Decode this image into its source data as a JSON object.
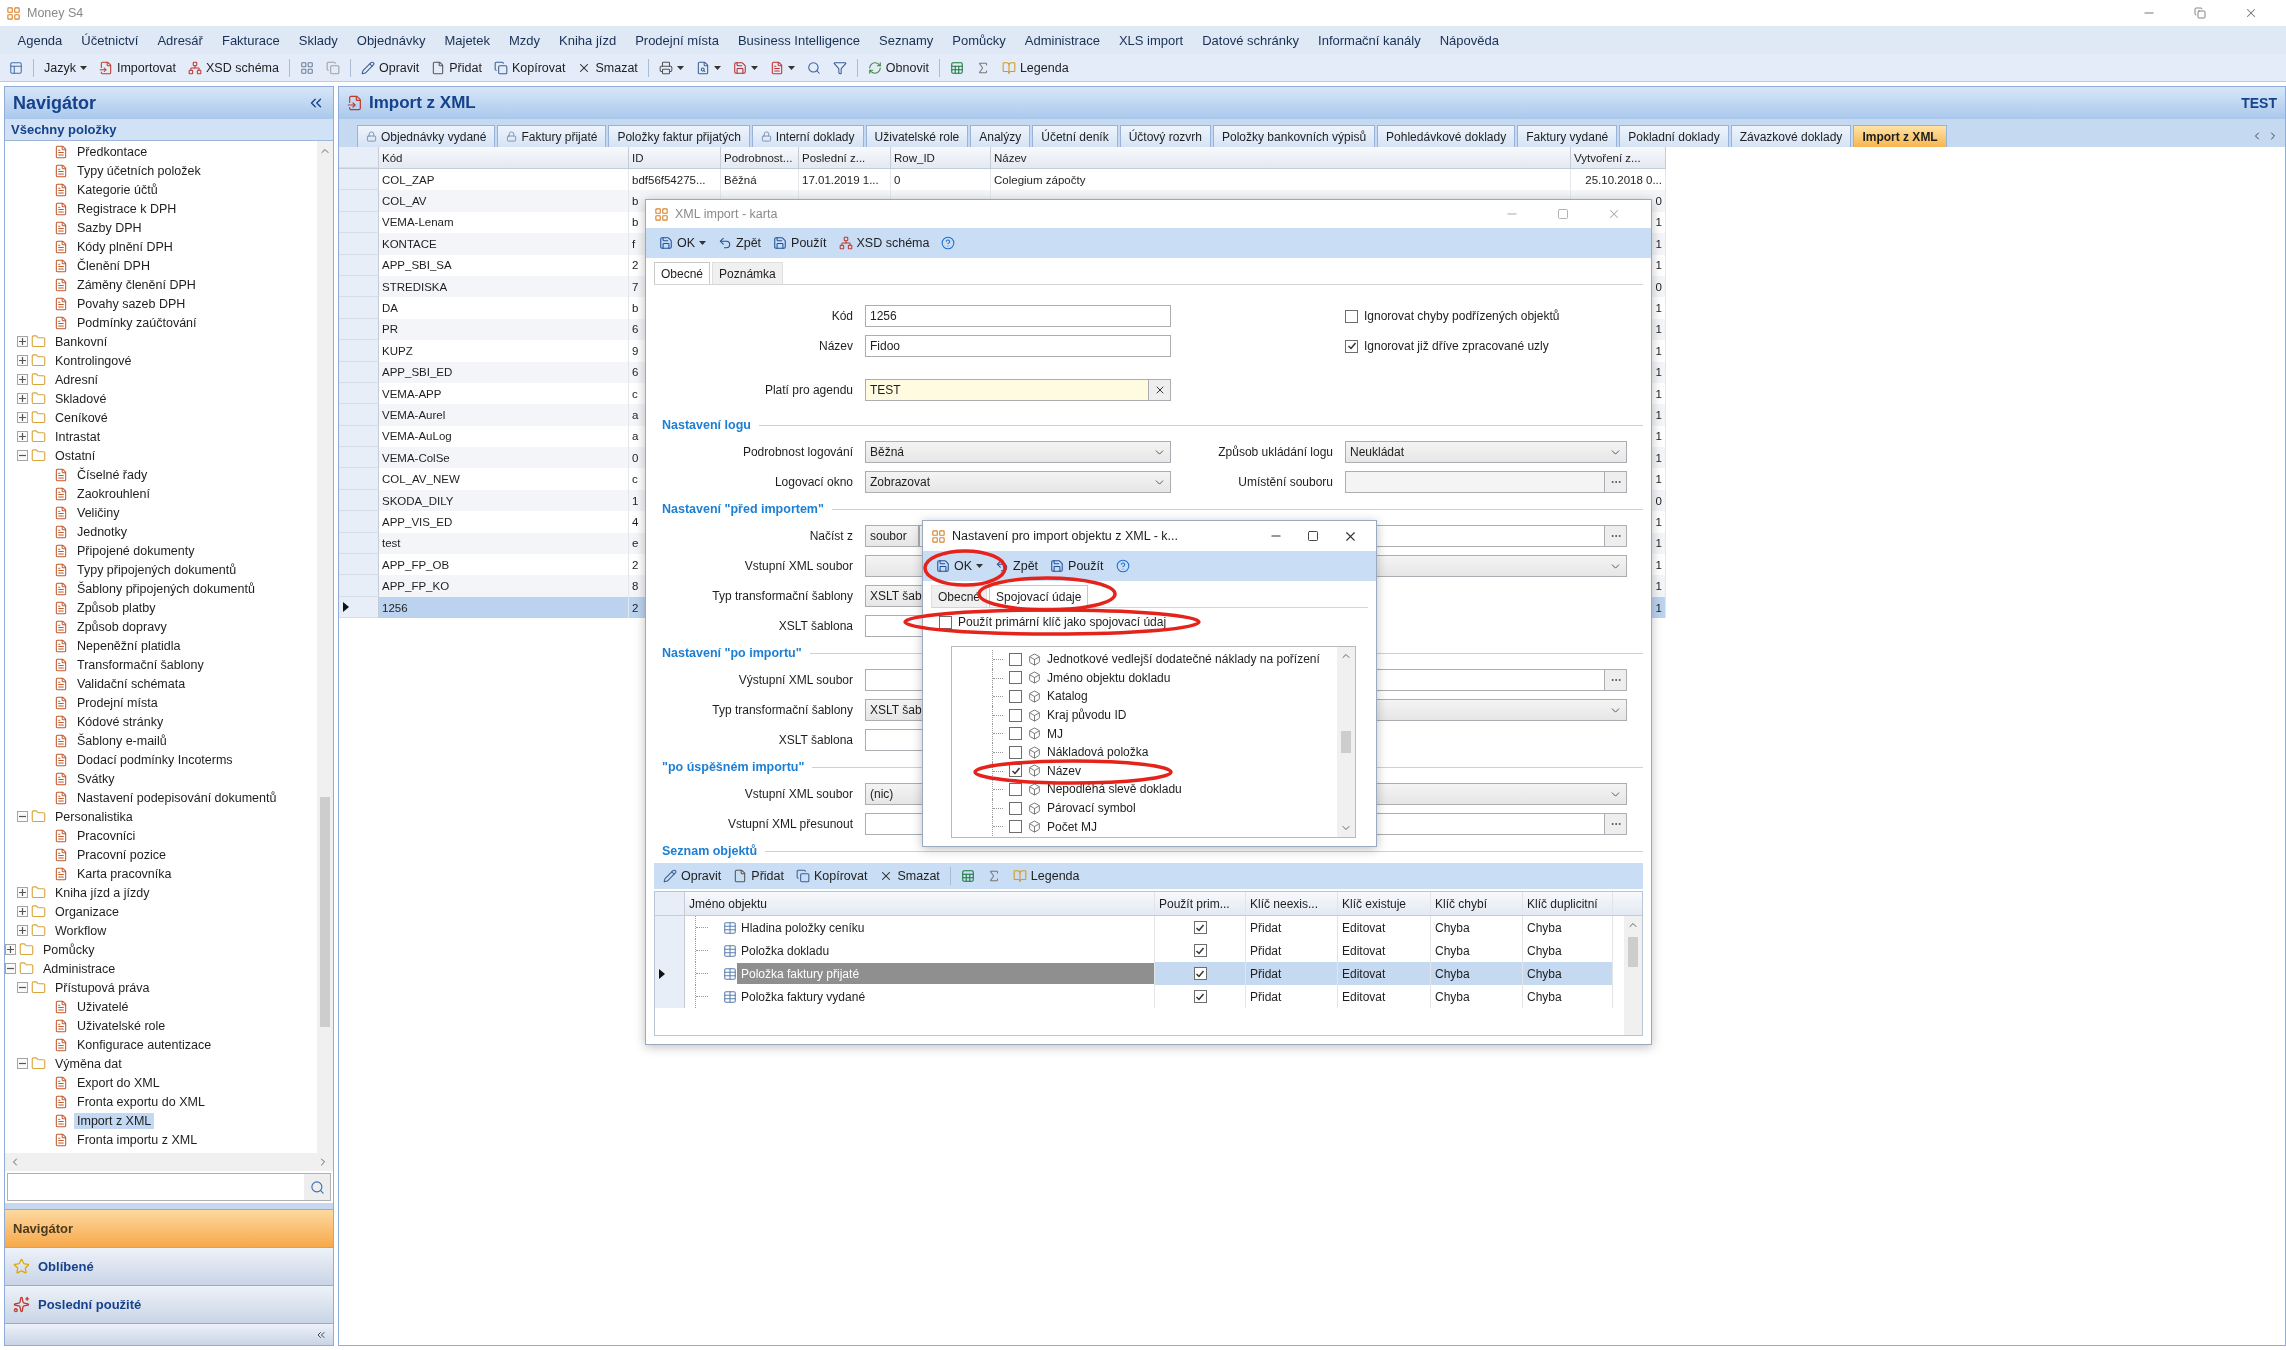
{
  "window": {
    "title": "Money S4"
  },
  "menu": [
    "Agenda",
    "Účetnictví",
    "Adresář",
    "Fakturace",
    "Sklady",
    "Objednávky",
    "Majetek",
    "Mzdy",
    "Kniha jízd",
    "Prodejní místa",
    "Business Intelligence",
    "Seznamy",
    "Pomůcky",
    "Administrace",
    "XLS import",
    "Datové schránky",
    "Informační kanály",
    "Nápověda"
  ],
  "toolbar": [
    {
      "kind": "icon"
    },
    {
      "kind": "button",
      "label": "Jazyk",
      "caret": true
    },
    {
      "kind": "button",
      "label": "Importovat"
    },
    {
      "kind": "button",
      "label": "XSD schéma"
    },
    {
      "kind": "icon"
    },
    {
      "kind": "icon"
    },
    {
      "kind": "button",
      "label": "Opravit"
    },
    {
      "kind": "button",
      "label": "Přidat"
    },
    {
      "kind": "button",
      "label": "Kopírovat"
    },
    {
      "kind": "button",
      "label": "Smazat"
    },
    {
      "kind": "icon",
      "caret": true
    },
    {
      "kind": "icon",
      "caret": true
    },
    {
      "kind": "icon",
      "caret": true
    },
    {
      "kind": "icon",
      "caret": true
    },
    {
      "kind": "icon"
    },
    {
      "kind": "icon"
    },
    {
      "kind": "button",
      "label": "Obnovit"
    },
    {
      "kind": "icon"
    },
    {
      "kind": "icon"
    },
    {
      "kind": "button",
      "label": "Legenda"
    }
  ],
  "navigator": {
    "title": "Navigátor",
    "group": "Všechny položky",
    "tree": [
      {
        "children": [
          {
            "children": [
              {
                "label": "Předkontace",
                "selected": false
              },
              {
                "label": "Typy účetních položek",
                "selected": false
              },
              {
                "label": "Kategorie účtů",
                "selected": false
              },
              {
                "label": "Registrace k DPH",
                "selected": false
              },
              {
                "label": "Sazby DPH",
                "selected": false
              },
              {
                "label": "Kódy plnění DPH",
                "selected": false
              },
              {
                "label": "Členění DPH",
                "selected": false
              },
              {
                "label": "Záměny členění DPH",
                "selected": false
              },
              {
                "label": "Povahy sazeb DPH",
                "selected": false
              },
              {
                "label": "Podmínky zaúčtování",
                "selected": false
              }
            ]
          },
          {
            "label": "Bankovní",
            "expanded": false,
            "selected": false
          },
          {
            "label": "Kontrolingové",
            "expanded": false,
            "selected": false
          },
          {
            "label": "Adresní",
            "expanded": false,
            "selected": false
          },
          {
            "label": "Skladové",
            "expanded": false,
            "selected": false
          },
          {
            "label": "Ceníkové",
            "expanded": false,
            "selected": false
          },
          {
            "label": "Intrastat",
            "expanded": false,
            "selected": false
          },
          {
            "label": "Ostatní",
            "expanded": true,
            "selected": false,
            "children": [
              {
                "label": "Číselné řady",
                "selected": false
              },
              {
                "label": "Zaokrouhlení",
                "selected": false
              },
              {
                "label": "Veličiny",
                "selected": false
              },
              {
                "label": "Jednotky",
                "selected": false
              },
              {
                "label": "Připojené dokumenty",
                "selected": false
              },
              {
                "label": "Typy připojených dokumentů",
                "selected": false
              },
              {
                "label": "Šablony připojených dokumentů",
                "selected": false
              },
              {
                "label": "Způsob platby",
                "selected": false
              },
              {
                "label": "Způsob dopravy",
                "selected": false
              },
              {
                "label": "Nepeněžní platidla",
                "selected": false
              },
              {
                "label": "Transformační šablony",
                "selected": false
              },
              {
                "label": "Validační schémata",
                "selected": false
              },
              {
                "label": "Prodejní místa",
                "selected": false
              },
              {
                "label": "Kódové stránky",
                "selected": false
              },
              {
                "label": "Šablony e-mailů",
                "selected": false
              },
              {
                "label": "Dodací podmínky Incoterms",
                "selected": false
              },
              {
                "label": "Svátky",
                "selected": false
              },
              {
                "label": "Nastavení podepisování dokumentů",
                "selected": false
              }
            ]
          },
          {
            "label": "Personalistika",
            "expanded": true,
            "selected": false,
            "children": [
              {
                "label": "Pracovníci",
                "selected": false
              },
              {
                "label": "Pracovní pozice",
                "selected": false
              },
              {
                "label": "Karta pracovníka",
                "selected": false
              }
            ]
          },
          {
            "label": "Kniha jízd a jízdy",
            "expanded": false,
            "selected": false
          },
          {
            "label": "Organizace",
            "expanded": false,
            "selected": false
          },
          {
            "label": "Workflow",
            "expanded": false,
            "selected": false
          }
        ]
      },
      {
        "label": "Pomůcky",
        "expanded": false,
        "selected": false
      },
      {
        "label": "Administrace",
        "expanded": true,
        "selected": false,
        "children": [
          {
            "label": "Přístupová práva",
            "expanded": true,
            "selected": false,
            "children": [
              {
                "label": "Uživatelé",
                "selected": false
              },
              {
                "label": "Uživatelské role",
                "selected": false
              },
              {
                "label": "Konfigurace autentizace",
                "selected": false
              }
            ]
          },
          {
            "label": "Výměna dat",
            "expanded": true,
            "selected": false,
            "children": [
              {
                "label": "Export do XML",
                "selected": false
              },
              {
                "label": "Fronta exportu do XML",
                "selected": false
              },
              {
                "label": "Import z XML",
                "selected": true
              },
              {
                "label": "Fronta importu z XML",
                "selected": false
              }
            ]
          }
        ]
      }
    ],
    "panes": [
      {
        "label": "Navigátor",
        "selected": true
      },
      {
        "label": "Oblíbené",
        "selected": false
      },
      {
        "label": "Poslední použité",
        "selected": false
      }
    ]
  },
  "page": {
    "title": "Import z XML",
    "agenda": "TEST",
    "tabs": [
      {
        "label": "Objednávky vydané",
        "locked": true,
        "selected": false
      },
      {
        "label": "Faktury přijaté",
        "locked": true,
        "selected": false
      },
      {
        "label": "Položky faktur přijatých",
        "locked": false,
        "selected": false
      },
      {
        "label": "Interní doklady",
        "locked": true,
        "selected": false
      },
      {
        "label": "Uživatelské role",
        "locked": false,
        "selected": false
      },
      {
        "label": "Analýzy",
        "locked": false,
        "selected": false
      },
      {
        "label": "Účetní deník",
        "locked": false,
        "selected": false
      },
      {
        "label": "Účtový rozvrh",
        "locked": false,
        "selected": false
      },
      {
        "label": "Položky bankovních výpisů",
        "locked": false,
        "selected": false
      },
      {
        "label": "Pohledávkové doklady",
        "locked": false,
        "selected": false
      },
      {
        "label": "Faktury vydané",
        "locked": false,
        "selected": false
      },
      {
        "label": "Pokladní doklady",
        "locked": false,
        "selected": false
      },
      {
        "label": "Závazkové doklady",
        "locked": false,
        "selected": false
      },
      {
        "label": "Import z XML",
        "locked": false,
        "selected": true
      }
    ],
    "table": {
      "columns": [
        "Kód",
        "ID",
        "Podrobnost...",
        "Poslední z...",
        "Row_ID",
        "Název",
        "Vytvoření z..."
      ],
      "rows": [
        {
          "code": "COL_ZAP",
          "id": "bdf56f54275...",
          "detail": "Běžná",
          "last": "17.01.2019 1...",
          "row_id": "0",
          "name": "Colegium zápočty",
          "created": "25.10.2018 0...",
          "selected": false
        },
        {
          "code": "COL_AV",
          "id": "b",
          "created": "0",
          "selected": false
        },
        {
          "code": "VEMA-Lenam",
          "id": "b",
          "created": "1",
          "selected": false
        },
        {
          "code": "KONTACE",
          "id": "f",
          "created": "1",
          "selected": false
        },
        {
          "code": "APP_SBI_SA",
          "id": "2",
          "created": "1",
          "selected": false
        },
        {
          "code": "STREDISKA",
          "id": "7",
          "created": "0",
          "selected": false
        },
        {
          "code": "DA",
          "id": "b",
          "created": "1",
          "selected": false
        },
        {
          "code": "PR",
          "id": "6",
          "created": "1",
          "selected": false
        },
        {
          "code": "KUPZ",
          "id": "9",
          "created": "1",
          "selected": false
        },
        {
          "code": "APP_SBI_ED",
          "id": "6",
          "created": "1",
          "selected": false
        },
        {
          "code": "VEMA-APP",
          "id": "c",
          "created": "1",
          "selected": false
        },
        {
          "code": "VEMA-Aurel",
          "id": "a",
          "created": "1",
          "selected": false
        },
        {
          "code": "VEMA-AuLog",
          "id": "a",
          "created": "1",
          "selected": false
        },
        {
          "code": "VEMA-ColSe",
          "id": "0",
          "created": "1",
          "selected": false
        },
        {
          "code": "COL_AV_NEW",
          "id": "c",
          "created": "1",
          "selected": false
        },
        {
          "code": "SKODA_DILY",
          "id": "1",
          "created": "0",
          "selected": false
        },
        {
          "code": "APP_VIS_ED",
          "id": "4",
          "created": "1",
          "selected": false
        },
        {
          "code": "test",
          "id": "e",
          "created": "1",
          "selected": false
        },
        {
          "code": "APP_FP_OB",
          "id": "2",
          "created": "1",
          "selected": false
        },
        {
          "code": "APP_FP_KO",
          "id": "8",
          "created": "1",
          "selected": false
        },
        {
          "code": "1256",
          "id": "2",
          "created": "1",
          "selected": true
        }
      ]
    }
  },
  "card": {
    "title": "XML import - karta",
    "toolbar": [
      {
        "kind": "button",
        "label": "OK",
        "caret": true
      },
      {
        "kind": "button",
        "label": "Zpět"
      },
      {
        "kind": "button",
        "label": "Použít"
      },
      {
        "kind": "button",
        "label": "XSD schéma"
      },
      {
        "kind": "icon"
      }
    ],
    "tabs": [
      {
        "label": "Obecné",
        "selected": true
      },
      {
        "label": "Poznámka",
        "selected": false
      }
    ],
    "code": {
      "label": "Kód",
      "value": "1256"
    },
    "name": {
      "label": "Název",
      "value": "Fidoo"
    },
    "agenda": {
      "label": "Platí pro agendu",
      "value": "TEST"
    },
    "options": [
      {
        "label": "Ignorovat chyby podřízených objektů",
        "checked": false
      },
      {
        "label": "Ignorovat již dříve zpracované uzly",
        "checked": true
      }
    ],
    "sections": [
      {
        "title": "Nastavení logu",
        "rows": [
          {
            "label": "Podrobnost logování",
            "kind": "combo",
            "value": "Běžná",
            "right": {
              "label": "Způsob ukládání logu",
              "kind": "combo",
              "value": "Neukládat"
            }
          },
          {
            "label": "Logovací okno",
            "kind": "combo",
            "value": "Zobrazovat",
            "right": {
              "label": "Umístění souboru",
              "kind": "browse"
            }
          }
        ]
      },
      {
        "title": "Nastavení \"před importem\"",
        "rows": [
          {
            "label": "Načíst z",
            "kind": "source",
            "value": "soubor"
          },
          {
            "label": "Vstupní XML soubor",
            "kind": "wide_combo"
          },
          {
            "label": "Typ transformační šablony",
            "kind": "partial_combo",
            "value": "XSLT šab"
          },
          {
            "label": "XSLT šablona",
            "kind": "text"
          }
        ]
      },
      {
        "title": "Nastavení \"po importu\"",
        "rows": [
          {
            "label": "Výstupní XML soubor",
            "kind": "wide_browse"
          },
          {
            "label": "Typ transformační šablony",
            "kind": "wide_combo",
            "value": "XSLT šab"
          },
          {
            "label": "XSLT šablona",
            "kind": "text"
          }
        ]
      },
      {
        "title": "\"po úspěšném importu\"",
        "rows": [
          {
            "label": "Vstupní XML soubor",
            "kind": "wide_combo",
            "value": "(nic)"
          },
          {
            "label": "Vstupní XML přesunout",
            "kind": "wide_browse"
          }
        ]
      }
    ],
    "objects": {
      "title": "Seznam objektů",
      "toolbar": [
        {
          "kind": "button",
          "label": "Opravit"
        },
        {
          "kind": "button",
          "label": "Přidat"
        },
        {
          "kind": "button",
          "label": "Kopírovat"
        },
        {
          "kind": "button",
          "label": "Smazat"
        },
        {
          "kind": "icon"
        },
        {
          "kind": "icon"
        },
        {
          "kind": "button",
          "label": "Legenda"
        }
      ],
      "columns": [
        "Jméno objektu",
        "Použít prim...",
        "Klíč neexis...",
        "Klíč existuje",
        "Klíč chybí",
        "Klíč duplicitní"
      ],
      "rows": [
        {
          "name": "Hladina položky ceníku",
          "primary": true,
          "missing": "Přidat",
          "exists": "Editovat",
          "absent": "Chyba",
          "duplicate": "Chyba",
          "selected": false
        },
        {
          "name": "Položka dokladu",
          "primary": true,
          "missing": "Přidat",
          "exists": "Editovat",
          "absent": "Chyba",
          "duplicate": "Chyba",
          "selected": false
        },
        {
          "name": "Položka faktury přijaté",
          "primary": true,
          "missing": "Přidat",
          "exists": "Editovat",
          "absent": "Chyba",
          "duplicate": "Chyba",
          "selected": true
        },
        {
          "name": "Položka faktury vydané",
          "primary": true,
          "missing": "Přidat",
          "exists": "Editovat",
          "absent": "Chyba",
          "duplicate": "Chyba",
          "selected": false
        }
      ]
    }
  },
  "object_dialog": {
    "title": "Nastavení pro import objektu z XML - k...",
    "toolbar": [
      {
        "kind": "button",
        "label": "OK",
        "caret": true,
        "annotated": true
      },
      {
        "kind": "button",
        "label": "Zpět",
        "annotated": false
      },
      {
        "kind": "button",
        "label": "Použít",
        "annotated": false
      },
      {
        "kind": "icon",
        "annotated": false
      }
    ],
    "tabs": [
      {
        "label": "Obecné",
        "selected": false,
        "annotated": false
      },
      {
        "label": "Spojovací údaje",
        "selected": true,
        "annotated": true
      }
    ],
    "primary_key": {
      "label": "Použít primární klíč jako spojovací údaj",
      "checked": false,
      "annotated": true
    },
    "items": [
      {
        "label": "Jednotkové vedlejší dodatečné náklady na pořízení",
        "checked": false,
        "annotated": false
      },
      {
        "label": "Jméno objektu dokladu",
        "checked": false,
        "annotated": false
      },
      {
        "label": "Katalog",
        "checked": false,
        "annotated": false
      },
      {
        "label": "Kraj původu ID",
        "checked": false,
        "annotated": false
      },
      {
        "label": "MJ",
        "checked": false,
        "annotated": false
      },
      {
        "label": "Nákladová položka",
        "checked": false,
        "annotated": false
      },
      {
        "label": "Název",
        "checked": true,
        "annotated": true
      },
      {
        "label": "Nepodléhá slevě dokladu",
        "checked": false,
        "annotated": false
      },
      {
        "label": "Párovací symbol",
        "checked": false,
        "annotated": false
      },
      {
        "label": "Počet MJ",
        "checked": false,
        "annotated": false
      }
    ]
  }
}
